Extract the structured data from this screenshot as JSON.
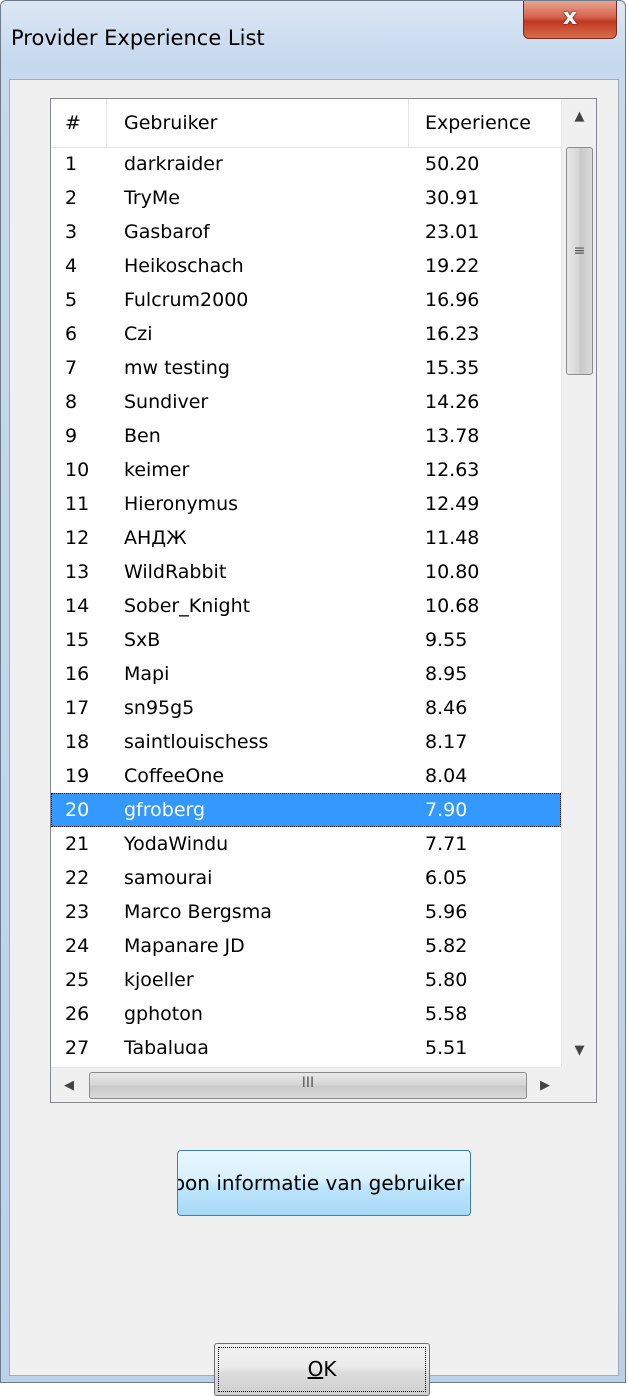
{
  "window": {
    "title": "Provider Experience List",
    "close_label": "x"
  },
  "list": {
    "columns": [
      "#",
      "Gebruiker",
      "Experience"
    ],
    "selected_index": 19,
    "rows": [
      {
        "rank": "1",
        "user": "darkraider",
        "exp": "50.20"
      },
      {
        "rank": "2",
        "user": "TryMe",
        "exp": "30.91"
      },
      {
        "rank": "3",
        "user": "Gasbarof",
        "exp": "23.01"
      },
      {
        "rank": "4",
        "user": "Heikoschach",
        "exp": "19.22"
      },
      {
        "rank": "5",
        "user": "Fulcrum2000",
        "exp": "16.96"
      },
      {
        "rank": "6",
        "user": "Czi",
        "exp": "16.23"
      },
      {
        "rank": "7",
        "user": "mw testing",
        "exp": "15.35"
      },
      {
        "rank": "8",
        "user": "Sundiver",
        "exp": "14.26"
      },
      {
        "rank": "9",
        "user": "Ben",
        "exp": "13.78"
      },
      {
        "rank": "10",
        "user": "keimer",
        "exp": "12.63"
      },
      {
        "rank": "11",
        "user": "Hieronymus",
        "exp": "12.49"
      },
      {
        "rank": "12",
        "user": "АНДЖ",
        "exp": "11.48"
      },
      {
        "rank": "13",
        "user": "WildRabbit",
        "exp": "10.80"
      },
      {
        "rank": "14",
        "user": "Sober_Knight",
        "exp": "10.68"
      },
      {
        "rank": "15",
        "user": "SxB",
        "exp": "9.55"
      },
      {
        "rank": "16",
        "user": "Mapi",
        "exp": "8.95"
      },
      {
        "rank": "17",
        "user": "sn95g5",
        "exp": "8.46"
      },
      {
        "rank": "18",
        "user": "saintlouischess",
        "exp": "8.17"
      },
      {
        "rank": "19",
        "user": "CoffeeOne",
        "exp": "8.04"
      },
      {
        "rank": "20",
        "user": "gfroberg",
        "exp": "7.90"
      },
      {
        "rank": "21",
        "user": "YodaWindu",
        "exp": "7.71"
      },
      {
        "rank": "22",
        "user": "samourai",
        "exp": "6.05"
      },
      {
        "rank": "23",
        "user": "Marco Bergsma",
        "exp": "5.96"
      },
      {
        "rank": "24",
        "user": "Mapanare JD",
        "exp": "5.82"
      },
      {
        "rank": "25",
        "user": "kjoeller",
        "exp": "5.80"
      },
      {
        "rank": "26",
        "user": "gphoton",
        "exp": "5.58"
      },
      {
        "rank": "27",
        "user": "Tabaluga",
        "exp": "5.51"
      }
    ]
  },
  "scrollbars": {
    "up_icon": "scroll-up-arrow",
    "down_icon": "scroll-down-arrow",
    "left_icon": "scroll-left-arrow",
    "right_icon": "scroll-right-arrow",
    "vthumb_grip": "≡",
    "hthumb_grip": "III"
  },
  "buttons": {
    "info_label": "Toon informatie van gebruiker zij",
    "ok_label": "OK"
  },
  "colors": {
    "selection": "#3399ff",
    "close_button": "#c0391f",
    "info_button": "#bee6fd"
  }
}
